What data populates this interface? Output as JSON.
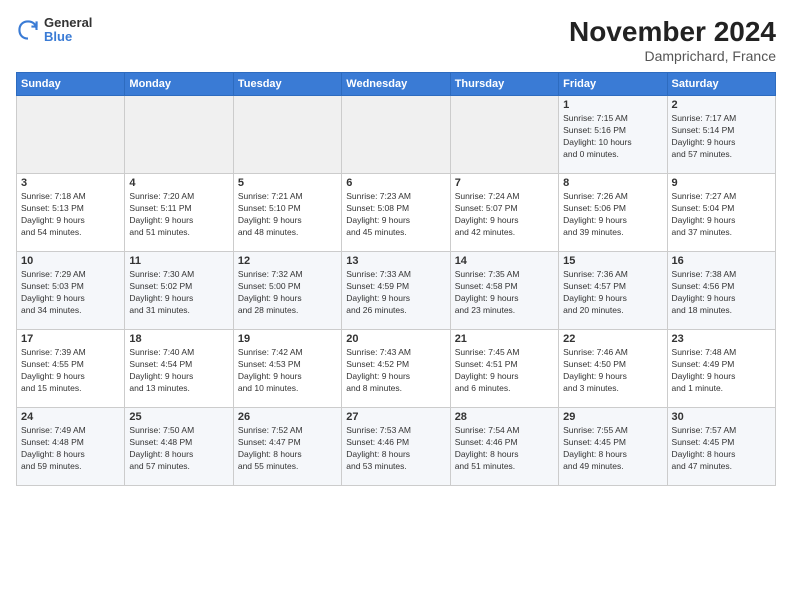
{
  "logo": {
    "general": "General",
    "blue": "Blue"
  },
  "title": "November 2024",
  "subtitle": "Damprichard, France",
  "headers": [
    "Sunday",
    "Monday",
    "Tuesday",
    "Wednesday",
    "Thursday",
    "Friday",
    "Saturday"
  ],
  "weeks": [
    [
      {
        "day": "",
        "info": ""
      },
      {
        "day": "",
        "info": ""
      },
      {
        "day": "",
        "info": ""
      },
      {
        "day": "",
        "info": ""
      },
      {
        "day": "",
        "info": ""
      },
      {
        "day": "1",
        "info": "Sunrise: 7:15 AM\nSunset: 5:16 PM\nDaylight: 10 hours\nand 0 minutes."
      },
      {
        "day": "2",
        "info": "Sunrise: 7:17 AM\nSunset: 5:14 PM\nDaylight: 9 hours\nand 57 minutes."
      }
    ],
    [
      {
        "day": "3",
        "info": "Sunrise: 7:18 AM\nSunset: 5:13 PM\nDaylight: 9 hours\nand 54 minutes."
      },
      {
        "day": "4",
        "info": "Sunrise: 7:20 AM\nSunset: 5:11 PM\nDaylight: 9 hours\nand 51 minutes."
      },
      {
        "day": "5",
        "info": "Sunrise: 7:21 AM\nSunset: 5:10 PM\nDaylight: 9 hours\nand 48 minutes."
      },
      {
        "day": "6",
        "info": "Sunrise: 7:23 AM\nSunset: 5:08 PM\nDaylight: 9 hours\nand 45 minutes."
      },
      {
        "day": "7",
        "info": "Sunrise: 7:24 AM\nSunset: 5:07 PM\nDaylight: 9 hours\nand 42 minutes."
      },
      {
        "day": "8",
        "info": "Sunrise: 7:26 AM\nSunset: 5:06 PM\nDaylight: 9 hours\nand 39 minutes."
      },
      {
        "day": "9",
        "info": "Sunrise: 7:27 AM\nSunset: 5:04 PM\nDaylight: 9 hours\nand 37 minutes."
      }
    ],
    [
      {
        "day": "10",
        "info": "Sunrise: 7:29 AM\nSunset: 5:03 PM\nDaylight: 9 hours\nand 34 minutes."
      },
      {
        "day": "11",
        "info": "Sunrise: 7:30 AM\nSunset: 5:02 PM\nDaylight: 9 hours\nand 31 minutes."
      },
      {
        "day": "12",
        "info": "Sunrise: 7:32 AM\nSunset: 5:00 PM\nDaylight: 9 hours\nand 28 minutes."
      },
      {
        "day": "13",
        "info": "Sunrise: 7:33 AM\nSunset: 4:59 PM\nDaylight: 9 hours\nand 26 minutes."
      },
      {
        "day": "14",
        "info": "Sunrise: 7:35 AM\nSunset: 4:58 PM\nDaylight: 9 hours\nand 23 minutes."
      },
      {
        "day": "15",
        "info": "Sunrise: 7:36 AM\nSunset: 4:57 PM\nDaylight: 9 hours\nand 20 minutes."
      },
      {
        "day": "16",
        "info": "Sunrise: 7:38 AM\nSunset: 4:56 PM\nDaylight: 9 hours\nand 18 minutes."
      }
    ],
    [
      {
        "day": "17",
        "info": "Sunrise: 7:39 AM\nSunset: 4:55 PM\nDaylight: 9 hours\nand 15 minutes."
      },
      {
        "day": "18",
        "info": "Sunrise: 7:40 AM\nSunset: 4:54 PM\nDaylight: 9 hours\nand 13 minutes."
      },
      {
        "day": "19",
        "info": "Sunrise: 7:42 AM\nSunset: 4:53 PM\nDaylight: 9 hours\nand 10 minutes."
      },
      {
        "day": "20",
        "info": "Sunrise: 7:43 AM\nSunset: 4:52 PM\nDaylight: 9 hours\nand 8 minutes."
      },
      {
        "day": "21",
        "info": "Sunrise: 7:45 AM\nSunset: 4:51 PM\nDaylight: 9 hours\nand 6 minutes."
      },
      {
        "day": "22",
        "info": "Sunrise: 7:46 AM\nSunset: 4:50 PM\nDaylight: 9 hours\nand 3 minutes."
      },
      {
        "day": "23",
        "info": "Sunrise: 7:48 AM\nSunset: 4:49 PM\nDaylight: 9 hours\nand 1 minute."
      }
    ],
    [
      {
        "day": "24",
        "info": "Sunrise: 7:49 AM\nSunset: 4:48 PM\nDaylight: 8 hours\nand 59 minutes."
      },
      {
        "day": "25",
        "info": "Sunrise: 7:50 AM\nSunset: 4:48 PM\nDaylight: 8 hours\nand 57 minutes."
      },
      {
        "day": "26",
        "info": "Sunrise: 7:52 AM\nSunset: 4:47 PM\nDaylight: 8 hours\nand 55 minutes."
      },
      {
        "day": "27",
        "info": "Sunrise: 7:53 AM\nSunset: 4:46 PM\nDaylight: 8 hours\nand 53 minutes."
      },
      {
        "day": "28",
        "info": "Sunrise: 7:54 AM\nSunset: 4:46 PM\nDaylight: 8 hours\nand 51 minutes."
      },
      {
        "day": "29",
        "info": "Sunrise: 7:55 AM\nSunset: 4:45 PM\nDaylight: 8 hours\nand 49 minutes."
      },
      {
        "day": "30",
        "info": "Sunrise: 7:57 AM\nSunset: 4:45 PM\nDaylight: 8 hours\nand 47 minutes."
      }
    ]
  ]
}
